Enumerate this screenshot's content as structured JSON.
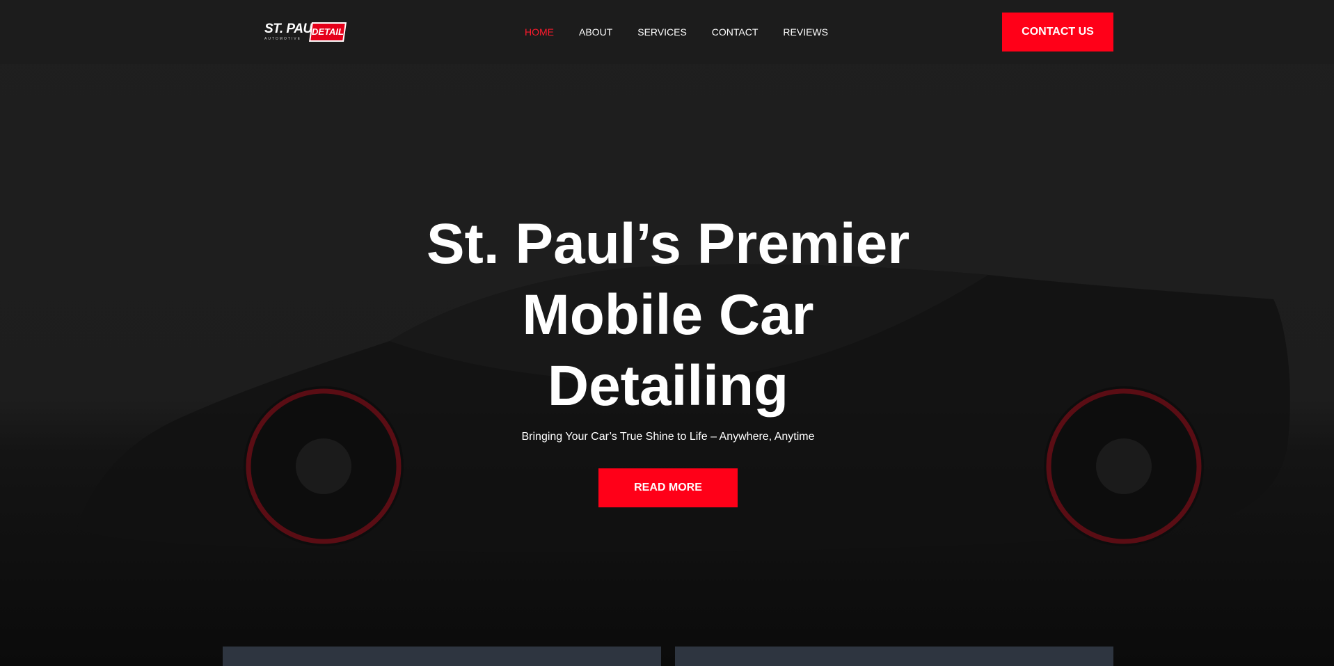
{
  "brand": {
    "logo_main": "ST. PAUL",
    "logo_badge": "DETAIL",
    "logo_sub": "AUTOMOTIVE"
  },
  "nav": {
    "items": [
      {
        "label": "HOME",
        "active": true
      },
      {
        "label": "ABOUT",
        "active": false
      },
      {
        "label": "SERVICES",
        "active": false
      },
      {
        "label": "CONTACT",
        "active": false
      },
      {
        "label": "REVIEWS",
        "active": false
      }
    ],
    "cta_label": "CONTACT US"
  },
  "hero": {
    "title_lines": [
      "St. Paul’s Premier",
      "Mobile Car",
      "Detailing"
    ],
    "subtitle": "Bringing Your Car’s True Shine to Life – Anywhere, Anytime",
    "button_label": "READ MORE"
  },
  "colors": {
    "accent": "#ff0018",
    "nav_active": "#ff1a2d",
    "background": "#1c1c1c",
    "panel": "#2e3540"
  }
}
